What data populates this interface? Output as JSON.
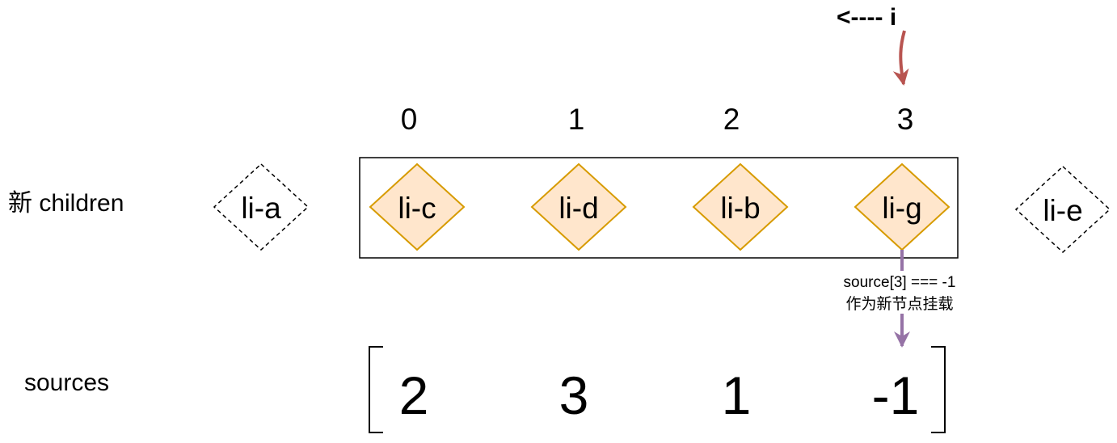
{
  "pointer": {
    "label": "<---- i",
    "arrow_color": "#b85450"
  },
  "indices": [
    "0",
    "1",
    "2",
    "3"
  ],
  "new_children": {
    "label": "新 children",
    "outside_left": "li-a",
    "items": [
      "li-c",
      "li-d",
      "li-b",
      "li-g"
    ],
    "outside_right": "li-e",
    "item_fill": "#ffe6cc",
    "item_stroke": "#d79b00"
  },
  "annotation": {
    "line1": "source[3] === -1",
    "line2": "作为新节点挂载",
    "color": "#9673a6"
  },
  "sources": {
    "label": "sources",
    "values": [
      "2",
      "3",
      "1",
      "-1"
    ]
  }
}
